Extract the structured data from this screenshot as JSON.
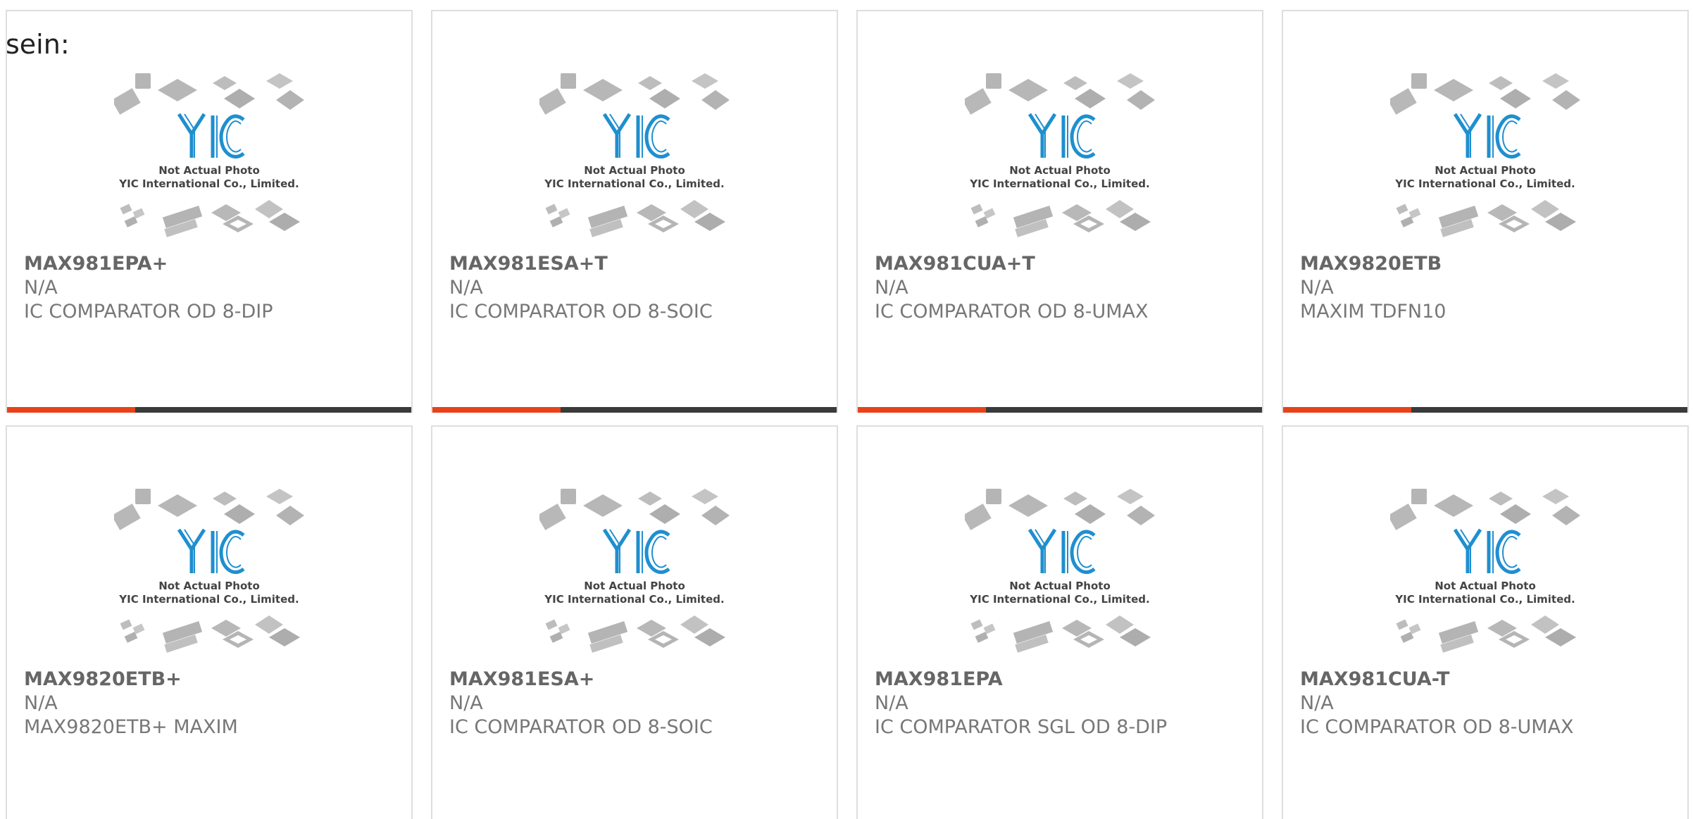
{
  "intro_text": "sein:",
  "image_caption": {
    "line1": "Not Actual Photo",
    "line2": "YIC International Co., Limited.",
    "logo": "YIC"
  },
  "colors": {
    "accent": "#e8421a",
    "bar": "#3a3a3a",
    "logo": "#1f8fcf"
  },
  "cards": [
    {
      "part": "MAX981EPA+",
      "stock": "N/A",
      "desc": "IC COMPARATOR OD 8-DIP"
    },
    {
      "part": "MAX981ESA+T",
      "stock": "N/A",
      "desc": "IC COMPARATOR OD 8-SOIC"
    },
    {
      "part": "MAX981CUA+T",
      "stock": "N/A",
      "desc": "IC COMPARATOR OD 8-UMAX"
    },
    {
      "part": "MAX9820ETB",
      "stock": "N/A",
      "desc": "MAXIM TDFN10"
    },
    {
      "part": "MAX9820ETB+",
      "stock": "N/A",
      "desc": "MAX9820ETB+ MAXIM"
    },
    {
      "part": "MAX981ESA+",
      "stock": "N/A",
      "desc": "IC COMPARATOR OD 8-SOIC"
    },
    {
      "part": "MAX981EPA",
      "stock": "N/A",
      "desc": "IC COMPARATOR SGL OD 8-DIP"
    },
    {
      "part": "MAX981CUA-T",
      "stock": "N/A",
      "desc": "IC COMPARATOR OD 8-UMAX"
    }
  ]
}
